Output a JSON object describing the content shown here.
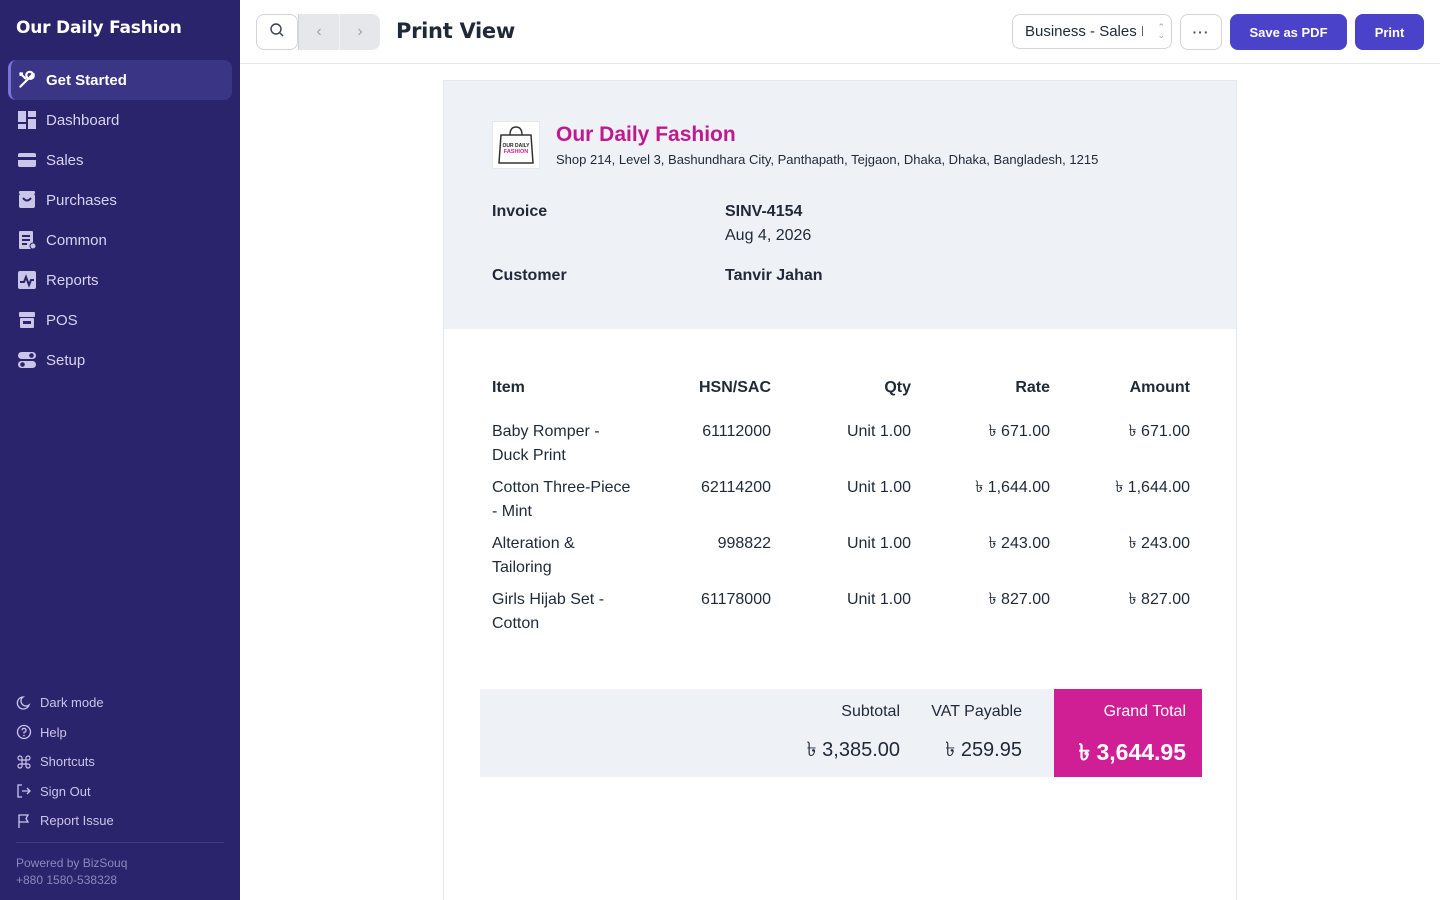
{
  "app": {
    "title": "Our Daily Fashion"
  },
  "sidebar": {
    "items": [
      {
        "label": "Get Started",
        "icon": "tools-icon",
        "active": true
      },
      {
        "label": "Dashboard",
        "icon": "dashboard-icon"
      },
      {
        "label": "Sales",
        "icon": "sales-icon"
      },
      {
        "label": "Purchases",
        "icon": "purchases-icon"
      },
      {
        "label": "Common",
        "icon": "common-icon"
      },
      {
        "label": "Reports",
        "icon": "reports-icon"
      },
      {
        "label": "POS",
        "icon": "pos-icon"
      },
      {
        "label": "Setup",
        "icon": "setup-icon"
      }
    ],
    "bottom": [
      {
        "label": "Dark mode",
        "icon": "moon-icon"
      },
      {
        "label": "Help",
        "icon": "help-icon"
      },
      {
        "label": "Shortcuts",
        "icon": "command-icon"
      },
      {
        "label": "Sign Out",
        "icon": "sign-out-icon"
      },
      {
        "label": "Report Issue",
        "icon": "flag-icon"
      }
    ],
    "powered_by": "Powered by BizSouq",
    "phone": "+880 1580-538328"
  },
  "toolbar": {
    "title": "Print View",
    "template_select": "Business - Sales Invoice",
    "more_label": "···",
    "save_pdf_label": "Save as PDF",
    "print_label": "Print"
  },
  "invoice": {
    "company_name": "Our Daily Fashion",
    "logo_text": [
      "OUR DAILY",
      "FASHION"
    ],
    "address": "Shop 214, Level 3, Bashundhara City, Panthapath, Tejgaon, Dhaka, Dhaka, Bangladesh, 1215",
    "invoice_label": "Invoice",
    "invoice_number": "SINV-4154",
    "date": "Aug 4, 2026",
    "customer_label": "Customer",
    "customer_name": "Tanvir Jahan",
    "columns": {
      "item": "Item",
      "hsn": "HSN/SAC",
      "qty": "Qty",
      "rate": "Rate",
      "amount": "Amount"
    },
    "rows": [
      {
        "item": [
          "Baby Romper -",
          "Duck Print"
        ],
        "hsn": "61112000",
        "qty": "Unit 1.00",
        "rate": "৳ 671.00",
        "amount": "৳ 671.00"
      },
      {
        "item": [
          "Cotton Three-Piece",
          "- Mint"
        ],
        "hsn": "62114200",
        "qty": "Unit 1.00",
        "rate": "৳ 1,644.00",
        "amount": "৳ 1,644.00"
      },
      {
        "item": [
          "Alteration &",
          "Tailoring"
        ],
        "hsn": "998822",
        "qty": "Unit 1.00",
        "rate": "৳ 243.00",
        "amount": "৳ 243.00"
      },
      {
        "item": [
          "Girls Hijab Set -",
          "Cotton"
        ],
        "hsn": "61178000",
        "qty": "Unit 1.00",
        "rate": "৳ 827.00",
        "amount": "৳ 827.00"
      }
    ],
    "totals": {
      "subtotal_label": "Subtotal",
      "subtotal": "৳ 3,385.00",
      "vat_label": "VAT Payable",
      "vat": "৳ 259.95",
      "grand_label": "Grand Total",
      "grand": "৳ 3,644.95"
    }
  },
  "colors": {
    "sidebar_bg": "#29246b",
    "accent_button": "#4a43c9",
    "brand_magenta": "#c0198f",
    "grand_total_bg": "#d01e94",
    "header_bg": "#eef1f6"
  }
}
